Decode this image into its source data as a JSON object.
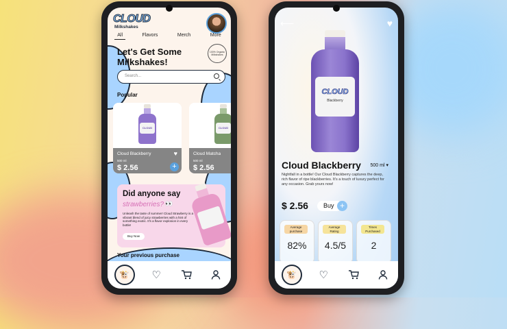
{
  "left_screen": {
    "brand": {
      "logo": "CLOUD",
      "sub": "Milkshakes"
    },
    "tabs": [
      {
        "label": "All",
        "active": true
      },
      {
        "label": "Flavors",
        "active": false
      },
      {
        "label": "Merch",
        "active": false
      },
      {
        "label": "More",
        "active": false
      }
    ],
    "headline_line1": "Let's Get Some",
    "headline_line2": "Milkshakes!",
    "seal_text": "100% Organic Milkshakes",
    "search": {
      "placeholder": "Search..."
    },
    "popular_title": "Popular",
    "products": [
      {
        "name": "Cloud Blackberry",
        "volume": "500 ml",
        "price": "$ 2.56",
        "color": "#8e73cc"
      },
      {
        "name": "Cloud Matcha",
        "volume": "500 ml",
        "price": "$ 2.56",
        "color": "#7a9a6a"
      }
    ],
    "promo": {
      "title": "Did anyone say",
      "flavor": "strawberries?",
      "eyes": "👀",
      "description": "Unleash the taste of summer! Cloud Strawberry is a vibrant blend of juicy strawberries with a hint of something exotic. It's a flavor explosion in every bottle!",
      "button": "Buy Now"
    },
    "previous_title": "Your previous purchase"
  },
  "right_screen": {
    "product": {
      "name": "Cloud Blackberry",
      "volume": "500 ml",
      "description": "Nightfall in a bottle! Our Cloud Blackberry captures the deep, rich flavor of ripe blackberries. It's a touch of luxury perfect for any occasion. Grab yours now!",
      "price": "$ 2.56",
      "buy_label": "Buy",
      "bottle_label": "CLOUD",
      "bottle_sub": "Blackberry"
    },
    "stats": [
      {
        "label": "Average purchase",
        "value": "82%",
        "color": "#f6d6a4"
      },
      {
        "label": "Average Rating",
        "value": "4.5/5",
        "color": "#f6e39a"
      },
      {
        "label": "Times Purchased",
        "value": "2",
        "color": "#f3e690"
      }
    ]
  },
  "icons": {
    "home": "cow-icon",
    "heart": "heart-icon",
    "cart": "cart-icon",
    "profile": "user-icon"
  }
}
